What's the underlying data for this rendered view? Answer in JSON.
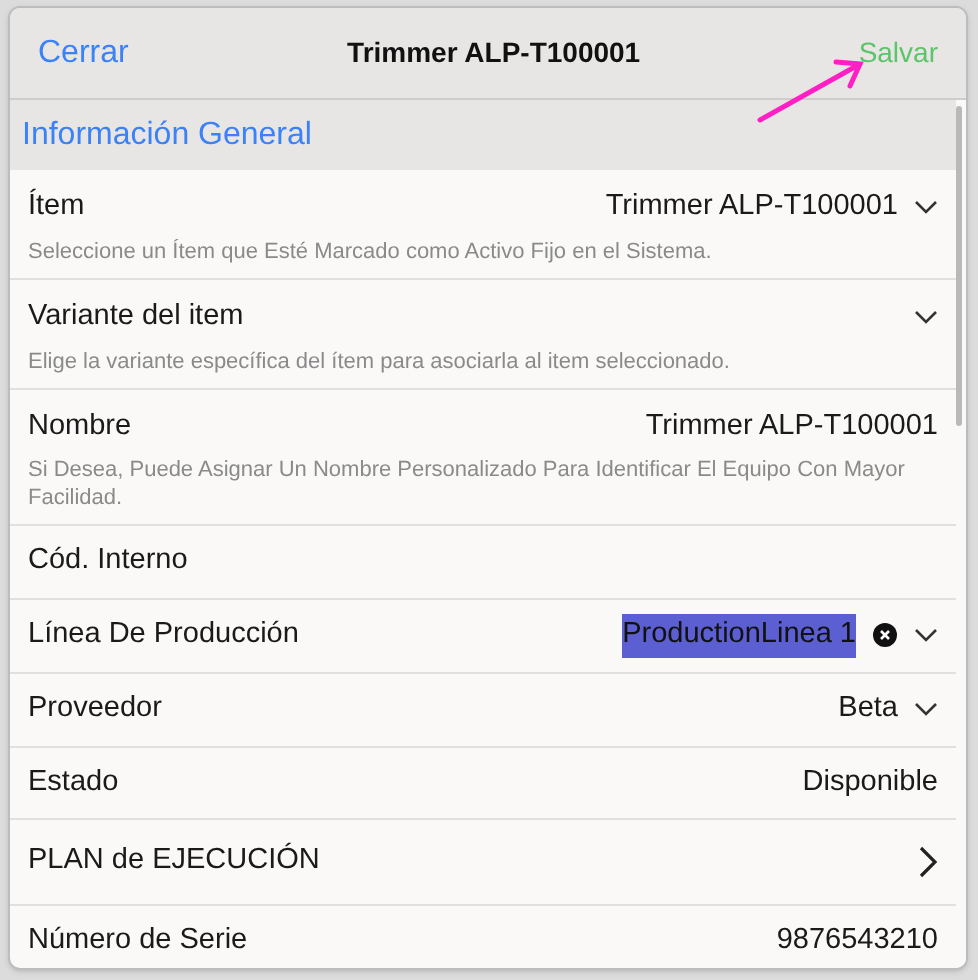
{
  "header": {
    "close": "Cerrar",
    "title": "Trimmer ALP-T100001",
    "save": "Salvar"
  },
  "section": "Información General",
  "fields": [
    {
      "kind": "select",
      "label": "Ítem",
      "value": "Trimmer ALP-T100001",
      "help": "Seleccione un Ítem que Esté Marcado como Activo Fijo en el Sistema."
    },
    {
      "kind": "select",
      "label": "Variante del item",
      "help": "Elige la variante específica del ítem para asociarla al item seleccionado."
    },
    {
      "kind": "text",
      "label": "Nombre",
      "value": "Trimmer ALP-T100001",
      "help": "Si Desea, Puede Asignar Un Nombre Personalizado Para Identificar El Equipo Con Mayor Facilidad."
    },
    {
      "kind": "text",
      "label": "Cód. Interno"
    },
    {
      "kind": "select",
      "label": "Línea De Producción",
      "value": "ProductionLinea 1",
      "value_highlighted": true,
      "clearable": true
    },
    {
      "kind": "select",
      "label": "Proveedor",
      "value": "Beta"
    },
    {
      "kind": "text",
      "label": "Estado",
      "value": "Disponible"
    },
    {
      "kind": "link",
      "label": "PLAN de EJECUCIÓN"
    },
    {
      "kind": "text",
      "label": "Número de Serie",
      "value": "9876543210"
    }
  ]
}
